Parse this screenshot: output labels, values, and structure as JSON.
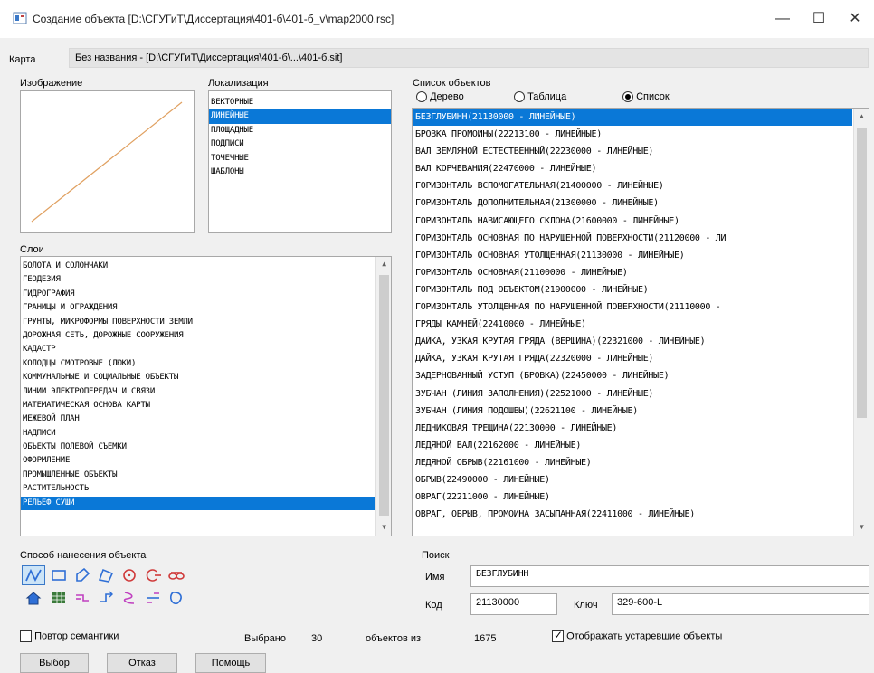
{
  "window": {
    "title": "Создание объекта [D:\\СГУГиТ\\Диссертация\\401-б\\401-б_v\\map2000.rsc]",
    "minimize": "—",
    "maximize": "☐",
    "close": "✕"
  },
  "map": {
    "label": "Карта",
    "value": "Без названия - [D:\\СГУГиТ\\Диссертация\\401-б\\...\\401-б.sit]"
  },
  "image_panel": {
    "label": "Изображение"
  },
  "localization": {
    "label": "Локализация",
    "items": [
      "ВЕКТОРНЫЕ",
      "ЛИНЕЙНЫЕ",
      "ПЛОЩАДНЫЕ",
      "ПОДПИСИ",
      "ТОЧЕЧНЫЕ",
      "ШАБЛОНЫ"
    ],
    "selected_index": 1
  },
  "layers": {
    "label": "Слои",
    "items": [
      "БОЛОТА И СОЛОНЧАКИ",
      "ГЕОДЕЗИЯ",
      "ГИДРОГРАФИЯ",
      "ГРАНИЦЫ И ОГРАЖДЕНИЯ",
      "ГРУНТЫ, МИКРОФОРМЫ ПОВЕРХНОСТИ ЗЕМЛИ",
      "ДОРОЖНАЯ СЕТЬ, ДОРОЖНЫЕ СООРУЖЕНИЯ",
      "КАДАСТР",
      "КОЛОДЦЫ СМОТРОВЫЕ (ЛЮКИ)",
      "КОММУНАЛЬНЫЕ И СОЦИАЛЬНЫЕ ОБЪЕКТЫ",
      "ЛИНИИ ЭЛЕКТРОПЕРЕДАЧ И СВЯЗИ",
      "МАТЕМАТИЧЕСКАЯ ОСНОВА КАРТЫ",
      "МЕЖЕВОЙ ПЛАН",
      "НАДПИСИ",
      "ОБЪЕКТЫ ПОЛЕВОЙ СЪЕМКИ",
      "ОФОРМЛЕНИЕ",
      "ПРОМЫШЛЕННЫЕ ОБЪЕКТЫ",
      "РАСТИТЕЛЬНОСТЬ",
      "РЕЛЬЕФ СУШИ"
    ],
    "selected_index": 17
  },
  "objects": {
    "label": "Список объектов",
    "view_options": [
      "Дерево",
      "Таблица",
      "Список"
    ],
    "selected_view": 2,
    "items": [
      "БЕЗГЛУБИНН(21130000 - ЛИНЕЙНЫЕ)",
      "БРОВКА ПРОМОИНЫ(22213100 - ЛИНЕЙНЫЕ)",
      "ВАЛ ЗЕМЛЯНОЙ ЕСТЕСТВЕННЫЙ(22230000 - ЛИНЕЙНЫЕ)",
      "ВАЛ КОРЧЕВАНИЯ(22470000 - ЛИНЕЙНЫЕ)",
      "ГОРИЗОНТАЛЬ ВСПОМОГАТЕЛЬНАЯ(21400000 - ЛИНЕЙНЫЕ)",
      "ГОРИЗОНТАЛЬ ДОПОЛНИТЕЛЬНАЯ(21300000 - ЛИНЕЙНЫЕ)",
      "ГОРИЗОНТАЛЬ НАВИСАЮЩЕГО СКЛОНА(21600000 - ЛИНЕЙНЫЕ)",
      "ГОРИЗОНТАЛЬ ОСНОВНАЯ ПО НАРУШЕННОЙ ПОВЕРХНОСТИ(21120000 - ЛИ",
      "ГОРИЗОНТАЛЬ ОСНОВНАЯ УТОЛЩЕННАЯ(21130000 - ЛИНЕЙНЫЕ)",
      "ГОРИЗОНТАЛЬ ОСНОВНАЯ(21100000 - ЛИНЕЙНЫЕ)",
      "ГОРИЗОНТАЛЬ ПОД ОБЪЕКТОМ(21900000 - ЛИНЕЙНЫЕ)",
      "ГОРИЗОНТАЛЬ УТОЛЩЕННАЯ ПО НАРУШЕННОЙ ПОВЕРХНОСТИ(21110000 -",
      "ГРЯДЫ КАМНЕЙ(22410000 - ЛИНЕЙНЫЕ)",
      "ДАЙКА, УЗКАЯ КРУТАЯ ГРЯДА (ВЕРШИНА)(22321000 - ЛИНЕЙНЫЕ)",
      "ДАЙКА, УЗКАЯ КРУТАЯ ГРЯДА(22320000 - ЛИНЕЙНЫЕ)",
      "ЗАДЕРНОВАННЫЙ УСТУП (БРОВКА)(22450000 - ЛИНЕЙНЫЕ)",
      "ЗУБЧАН (ЛИНИЯ ЗАПОЛНЕНИЯ)(22521000 - ЛИНЕЙНЫЕ)",
      "ЗУБЧАН (ЛИНИЯ ПОДОШВЫ)(22621100 - ЛИНЕЙНЫЕ)",
      "ЛЕДНИКОВАЯ ТРЕЩИНА(22130000 - ЛИНЕЙНЫЕ)",
      "ЛЕДЯНОЙ ВАЛ(22162000 - ЛИНЕЙНЫЕ)",
      "ЛЕДЯНОЙ ОБРЫВ(22161000 - ЛИНЕЙНЫЕ)",
      "ОБРЫВ(22490000 - ЛИНЕЙНЫЕ)",
      "ОВРАГ(22211000 - ЛИНЕЙНЫЕ)",
      "ОВРАГ, ОБРЫВ, ПРОМОИНА ЗАСЫПАННАЯ(22411000 - ЛИНЕЙНЫЕ)"
    ],
    "selected_index": 0
  },
  "draw_method": {
    "label": "Способ нанесения объекта",
    "tools": [
      "polyline-tool-icon",
      "rectangle-tool-icon",
      "polygon-tool-icon",
      "rotated-polygon-tool-icon",
      "circle-tool-icon",
      "circle-arc-tool-icon",
      "ellipse-tool-icon",
      "house-tool-icon",
      "grid-tool-icon",
      "parallel-line-tool-icon",
      "arrow-line-tool-icon",
      "curve-tool-icon",
      "offset-line-tool-icon",
      "spline-area-tool-icon"
    ],
    "active_tool": 0
  },
  "search": {
    "label": "Поиск",
    "name_label": "Имя",
    "name_value": "БЕЗГЛУБИНН",
    "code_label": "Код",
    "code_value": "21130000",
    "key_label": "Ключ",
    "key_value": "329-600-L"
  },
  "status": {
    "repeat_semantics_label": "Повтор семантики",
    "selected_label": "Выбрано",
    "selected_count": "30",
    "objects_of_label": "объектов из",
    "total_count": "1675",
    "show_obsolete_label": "Отображать устаревшие объекты",
    "show_obsolete_checked": true,
    "repeat_semantics_checked": false
  },
  "buttons": {
    "choose": "Выбор",
    "cancel": "Отказ",
    "help": "Помощь"
  },
  "colors": {
    "selection": "#0a78d7",
    "preview_line": "#e0a060",
    "tool_blue": "#2f6fd6",
    "tool_red": "#d03a3a",
    "tool_magenta": "#c040c0"
  }
}
